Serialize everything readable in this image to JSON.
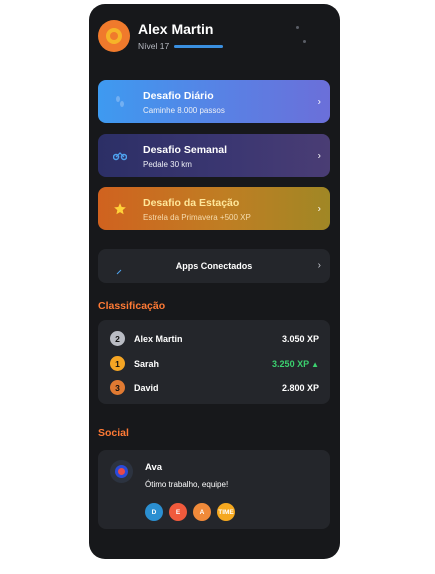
{
  "user": {
    "name": "Alex Martin",
    "level": "Nível 17",
    "level_progress": 1.0
  },
  "challenges": [
    {
      "title": "Desafio Diário",
      "subtitle": "Caminhe 8.000 passos",
      "icon": "footsteps-icon"
    },
    {
      "title": "Desafio Semanal",
      "subtitle": "Pedale 30 km",
      "icon": "bike-icon"
    },
    {
      "title": "Desafio da Estação",
      "subtitle": "Estrela da Primavera +500 XP",
      "icon": "star-icon"
    }
  ],
  "apps": {
    "label": "Apps Conectados",
    "icon": "link-icon"
  },
  "leaderboard": {
    "title": "Classificação",
    "rows": [
      {
        "rank": "2",
        "name": "Alex Martin",
        "xp": "3.050 XP",
        "rank_color": "#b9bcc4",
        "trend": ""
      },
      {
        "rank": "1",
        "name": "Sarah",
        "xp": "3.250 XP",
        "rank_color": "#f5a524",
        "trend": "▲"
      },
      {
        "rank": "3",
        "name": "David",
        "xp": "2.800 XP",
        "rank_color": "#e07a32",
        "trend": ""
      }
    ]
  },
  "social": {
    "title": "Social",
    "post": {
      "author": "Ava",
      "message": "Ótimo trabalho, equipe!"
    },
    "reactions": [
      {
        "label": "D",
        "color": "#2b8fd1"
      },
      {
        "label": "E",
        "color": "#f05a3c"
      },
      {
        "label": "A",
        "color": "#f08a3a"
      },
      {
        "label": "TIME",
        "color": "#f5a81f"
      }
    ]
  },
  "colors": {
    "accent": "#ff7a35",
    "background": "#17181b",
    "card": "#24262b",
    "positive": "#3bd16f"
  }
}
